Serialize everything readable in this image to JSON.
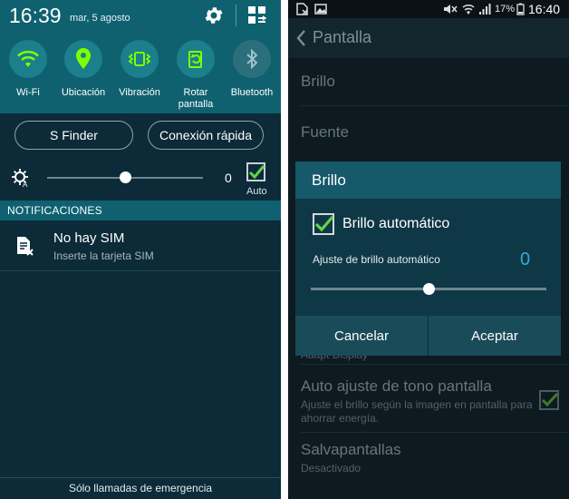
{
  "left": {
    "time": "16:39",
    "date": "mar, 5 agosto",
    "quick_settings": [
      {
        "label": "Wi-Fi",
        "icon": "wifi-icon"
      },
      {
        "label": "Ubicación",
        "icon": "location-pin-icon"
      },
      {
        "label": "Vibración",
        "icon": "vibration-icon"
      },
      {
        "label": "Rotar pantalla",
        "icon": "rotate-screen-icon"
      },
      {
        "label": "Bluetooth",
        "icon": "bluetooth-icon"
      }
    ],
    "buttons": {
      "s_finder": "S Finder",
      "quick_connect": "Conexión rápida"
    },
    "brightness": {
      "value": "0",
      "auto_label": "Auto",
      "auto_checked": true,
      "level": 0.5
    },
    "notifications_header": "NOTIFICACIONES",
    "notification": {
      "title": "No hay SIM",
      "subtitle": "Inserte la tarjeta SIM"
    },
    "footer": "Sólo llamadas de emergencia"
  },
  "right": {
    "status_bar": {
      "battery": "17%",
      "time": "16:40"
    },
    "app_bar_title": "Pantalla",
    "settings": {
      "brillo": "Brillo",
      "fuente": "Fuente",
      "adapt_display": "Adapt Display",
      "auto_tone_title": "Auto ajuste de tono pantalla",
      "auto_tone_sub": "Ajuste el brillo según la imagen en pantalla para ahorrar energía.",
      "screensaver_title": "Salvapantallas",
      "screensaver_sub": "Desactivado"
    },
    "dialog": {
      "title": "Brillo",
      "auto_brightness_label": "Brillo automático",
      "auto_brightness_checked": true,
      "adjust_label": "Ajuste de brillo automático",
      "adjust_value": "0",
      "level": 0.5,
      "cancel": "Cancelar",
      "accept": "Aceptar"
    }
  },
  "colors": {
    "panel_teal": "#0f6170",
    "toggle_active": "#1b7f8c",
    "check_green": "#63d44a",
    "dialog_accent": "#38a8d6"
  }
}
